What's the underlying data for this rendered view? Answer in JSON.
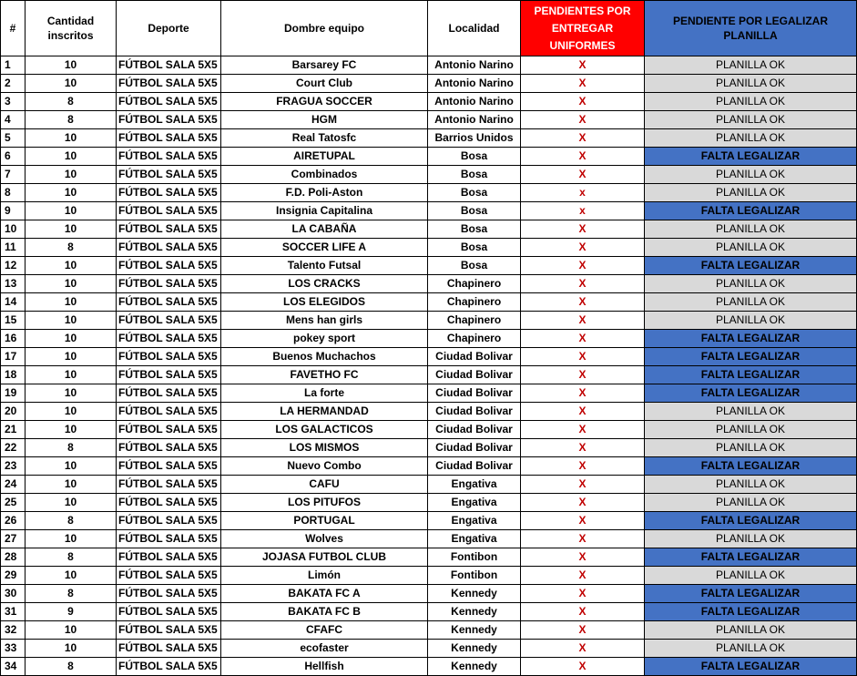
{
  "colors": {
    "pendientes_header_bg": "#ff0000",
    "planilla_header_bg": "#4472c4",
    "planilla_ok_bg": "#d9d9d9",
    "falta_legalizar_bg": "#4472c4",
    "x_mark": "#c00000"
  },
  "headers": {
    "num": "#",
    "cantidad": "Cantidad inscritos",
    "deporte": "Deporte",
    "nombre": "Dombre equipo",
    "localidad": "Localidad",
    "pendientes": "PENDIENTES POR ENTREGAR UNIFORMES",
    "planilla": "PENDIENTE POR LEGALIZAR PLANILLA"
  },
  "rows": [
    {
      "num": "1",
      "cantidad": "10",
      "deporte": "FÚTBOL SALA 5X5",
      "equipo": "Barsarey FC",
      "localidad": "Antonio Narino",
      "pendiente": "X",
      "planilla": "PLANILLA OK"
    },
    {
      "num": "2",
      "cantidad": "10",
      "deporte": "FÚTBOL SALA 5X5",
      "equipo": "Court Club",
      "localidad": "Antonio Narino",
      "pendiente": "X",
      "planilla": "PLANILLA OK"
    },
    {
      "num": "3",
      "cantidad": "8",
      "deporte": "FÚTBOL SALA 5X5",
      "equipo": "FRAGUA SOCCER",
      "localidad": "Antonio Narino",
      "pendiente": "X",
      "planilla": "PLANILLA OK"
    },
    {
      "num": "4",
      "cantidad": "8",
      "deporte": "FÚTBOL SALA 5X5",
      "equipo": "HGM",
      "localidad": "Antonio Narino",
      "pendiente": "X",
      "planilla": "PLANILLA OK"
    },
    {
      "num": "5",
      "cantidad": "10",
      "deporte": "FÚTBOL SALA 5X5",
      "equipo": "Real Tatosfc",
      "localidad": "Barrios Unidos",
      "pendiente": "X",
      "planilla": "PLANILLA OK"
    },
    {
      "num": "6",
      "cantidad": "10",
      "deporte": "FÚTBOL SALA 5X5",
      "equipo": "AIRETUPAL",
      "localidad": "Bosa",
      "pendiente": "X",
      "planilla": "FALTA LEGALIZAR"
    },
    {
      "num": "7",
      "cantidad": "10",
      "deporte": "FÚTBOL SALA 5X5",
      "equipo": "Combinados",
      "localidad": "Bosa",
      "pendiente": "X",
      "planilla": "PLANILLA OK"
    },
    {
      "num": "8",
      "cantidad": "10",
      "deporte": "FÚTBOL SALA 5X5",
      "equipo": "F.D. Poli-Aston",
      "localidad": "Bosa",
      "pendiente": "x",
      "planilla": "PLANILLA OK"
    },
    {
      "num": "9",
      "cantidad": "10",
      "deporte": "FÚTBOL SALA 5X5",
      "equipo": "Insignia Capitalina",
      "localidad": "Bosa",
      "pendiente": "x",
      "planilla": "FALTA LEGALIZAR"
    },
    {
      "num": "10",
      "cantidad": "10",
      "deporte": "FÚTBOL SALA 5X5",
      "equipo": "LA CABAÑA",
      "localidad": "Bosa",
      "pendiente": "X",
      "planilla": "PLANILLA OK"
    },
    {
      "num": "11",
      "cantidad": "8",
      "deporte": "FÚTBOL SALA 5X5",
      "equipo": "SOCCER LIFE A",
      "localidad": "Bosa",
      "pendiente": "X",
      "planilla": "PLANILLA OK"
    },
    {
      "num": "12",
      "cantidad": "10",
      "deporte": "FÚTBOL SALA 5X5",
      "equipo": "Talento Futsal",
      "localidad": "Bosa",
      "pendiente": "X",
      "planilla": "FALTA LEGALIZAR"
    },
    {
      "num": "13",
      "cantidad": "10",
      "deporte": "FÚTBOL SALA 5X5",
      "equipo": "LOS CRACKS",
      "localidad": "Chapinero",
      "pendiente": "X",
      "planilla": "PLANILLA OK"
    },
    {
      "num": "14",
      "cantidad": "10",
      "deporte": "FÚTBOL SALA 5X5",
      "equipo": "LOS ELEGIDOS",
      "localidad": "Chapinero",
      "pendiente": "X",
      "planilla": "PLANILLA OK"
    },
    {
      "num": "15",
      "cantidad": "10",
      "deporte": "FÚTBOL SALA 5X5",
      "equipo": "Mens han girls",
      "localidad": "Chapinero",
      "pendiente": "X",
      "planilla": "PLANILLA OK"
    },
    {
      "num": "16",
      "cantidad": "10",
      "deporte": "FÚTBOL SALA 5X5",
      "equipo": "pokey sport",
      "localidad": "Chapinero",
      "pendiente": "X",
      "planilla": "FALTA LEGALIZAR"
    },
    {
      "num": "17",
      "cantidad": "10",
      "deporte": "FÚTBOL SALA 5X5",
      "equipo": "Buenos Muchachos",
      "localidad": "Ciudad Bolivar",
      "pendiente": "X",
      "planilla": "FALTA LEGALIZAR"
    },
    {
      "num": "18",
      "cantidad": "10",
      "deporte": "FÚTBOL SALA 5X5",
      "equipo": "FAVETHO FC",
      "localidad": "Ciudad Bolivar",
      "pendiente": "X",
      "planilla": "FALTA LEGALIZAR"
    },
    {
      "num": "19",
      "cantidad": "10",
      "deporte": "FÚTBOL SALA 5X5",
      "equipo": "La forte",
      "localidad": "Ciudad Bolivar",
      "pendiente": "X",
      "planilla": "FALTA LEGALIZAR"
    },
    {
      "num": "20",
      "cantidad": "10",
      "deporte": "FÚTBOL SALA 5X5",
      "equipo": "LA HERMANDAD",
      "localidad": "Ciudad Bolivar",
      "pendiente": "X",
      "planilla": "PLANILLA OK"
    },
    {
      "num": "21",
      "cantidad": "10",
      "deporte": "FÚTBOL SALA 5X5",
      "equipo": "LOS GALACTICOS",
      "localidad": "Ciudad Bolivar",
      "pendiente": "X",
      "planilla": "PLANILLA OK"
    },
    {
      "num": "22",
      "cantidad": "8",
      "deporte": "FÚTBOL SALA 5X5",
      "equipo": "LOS MISMOS",
      "localidad": "Ciudad Bolivar",
      "pendiente": "X",
      "planilla": "PLANILLA OK"
    },
    {
      "num": "23",
      "cantidad": "10",
      "deporte": "FÚTBOL SALA 5X5",
      "equipo": "Nuevo Combo",
      "localidad": "Ciudad Bolivar",
      "pendiente": "X",
      "planilla": "FALTA LEGALIZAR"
    },
    {
      "num": "24",
      "cantidad": "10",
      "deporte": "FÚTBOL SALA 5X5",
      "equipo": "CAFU",
      "localidad": "Engativa",
      "pendiente": "X",
      "planilla": "PLANILLA OK"
    },
    {
      "num": "25",
      "cantidad": "10",
      "deporte": "FÚTBOL SALA 5X5",
      "equipo": "LOS PITUFOS",
      "localidad": "Engativa",
      "pendiente": "X",
      "planilla": "PLANILLA OK"
    },
    {
      "num": "26",
      "cantidad": "8",
      "deporte": "FÚTBOL SALA 5X5",
      "equipo": "PORTUGAL",
      "localidad": "Engativa",
      "pendiente": "X",
      "planilla": "FALTA LEGALIZAR"
    },
    {
      "num": "27",
      "cantidad": "10",
      "deporte": "FÚTBOL SALA 5X5",
      "equipo": "Wolves",
      "localidad": "Engativa",
      "pendiente": "X",
      "planilla": "PLANILLA OK"
    },
    {
      "num": "28",
      "cantidad": "8",
      "deporte": "FÚTBOL SALA 5X5",
      "equipo": "JOJASA FUTBOL CLUB",
      "localidad": "Fontibon",
      "pendiente": "X",
      "planilla": "FALTA LEGALIZAR"
    },
    {
      "num": "29",
      "cantidad": "10",
      "deporte": "FÚTBOL SALA 5X5",
      "equipo": "Limón",
      "localidad": "Fontibon",
      "pendiente": "X",
      "planilla": "PLANILLA OK"
    },
    {
      "num": "30",
      "cantidad": "8",
      "deporte": "FÚTBOL SALA 5X5",
      "equipo": "BAKATA FC A",
      "localidad": "Kennedy",
      "pendiente": "X",
      "planilla": "FALTA LEGALIZAR"
    },
    {
      "num": "31",
      "cantidad": "9",
      "deporte": "FÚTBOL SALA 5X5",
      "equipo": "BAKATA FC B",
      "localidad": "Kennedy",
      "pendiente": "X",
      "planilla": "FALTA LEGALIZAR"
    },
    {
      "num": "32",
      "cantidad": "10",
      "deporte": "FÚTBOL SALA 5X5",
      "equipo": "CFAFC",
      "localidad": "Kennedy",
      "pendiente": "X",
      "planilla": "PLANILLA OK"
    },
    {
      "num": "33",
      "cantidad": "10",
      "deporte": "FÚTBOL SALA 5X5",
      "equipo": "ecofaster",
      "localidad": "Kennedy",
      "pendiente": "X",
      "planilla": "PLANILLA OK"
    },
    {
      "num": "34",
      "cantidad": "8",
      "deporte": "FÚTBOL SALA 5X5",
      "equipo": "Hellfish",
      "localidad": "Kennedy",
      "pendiente": "X",
      "planilla": "FALTA LEGALIZAR"
    }
  ]
}
